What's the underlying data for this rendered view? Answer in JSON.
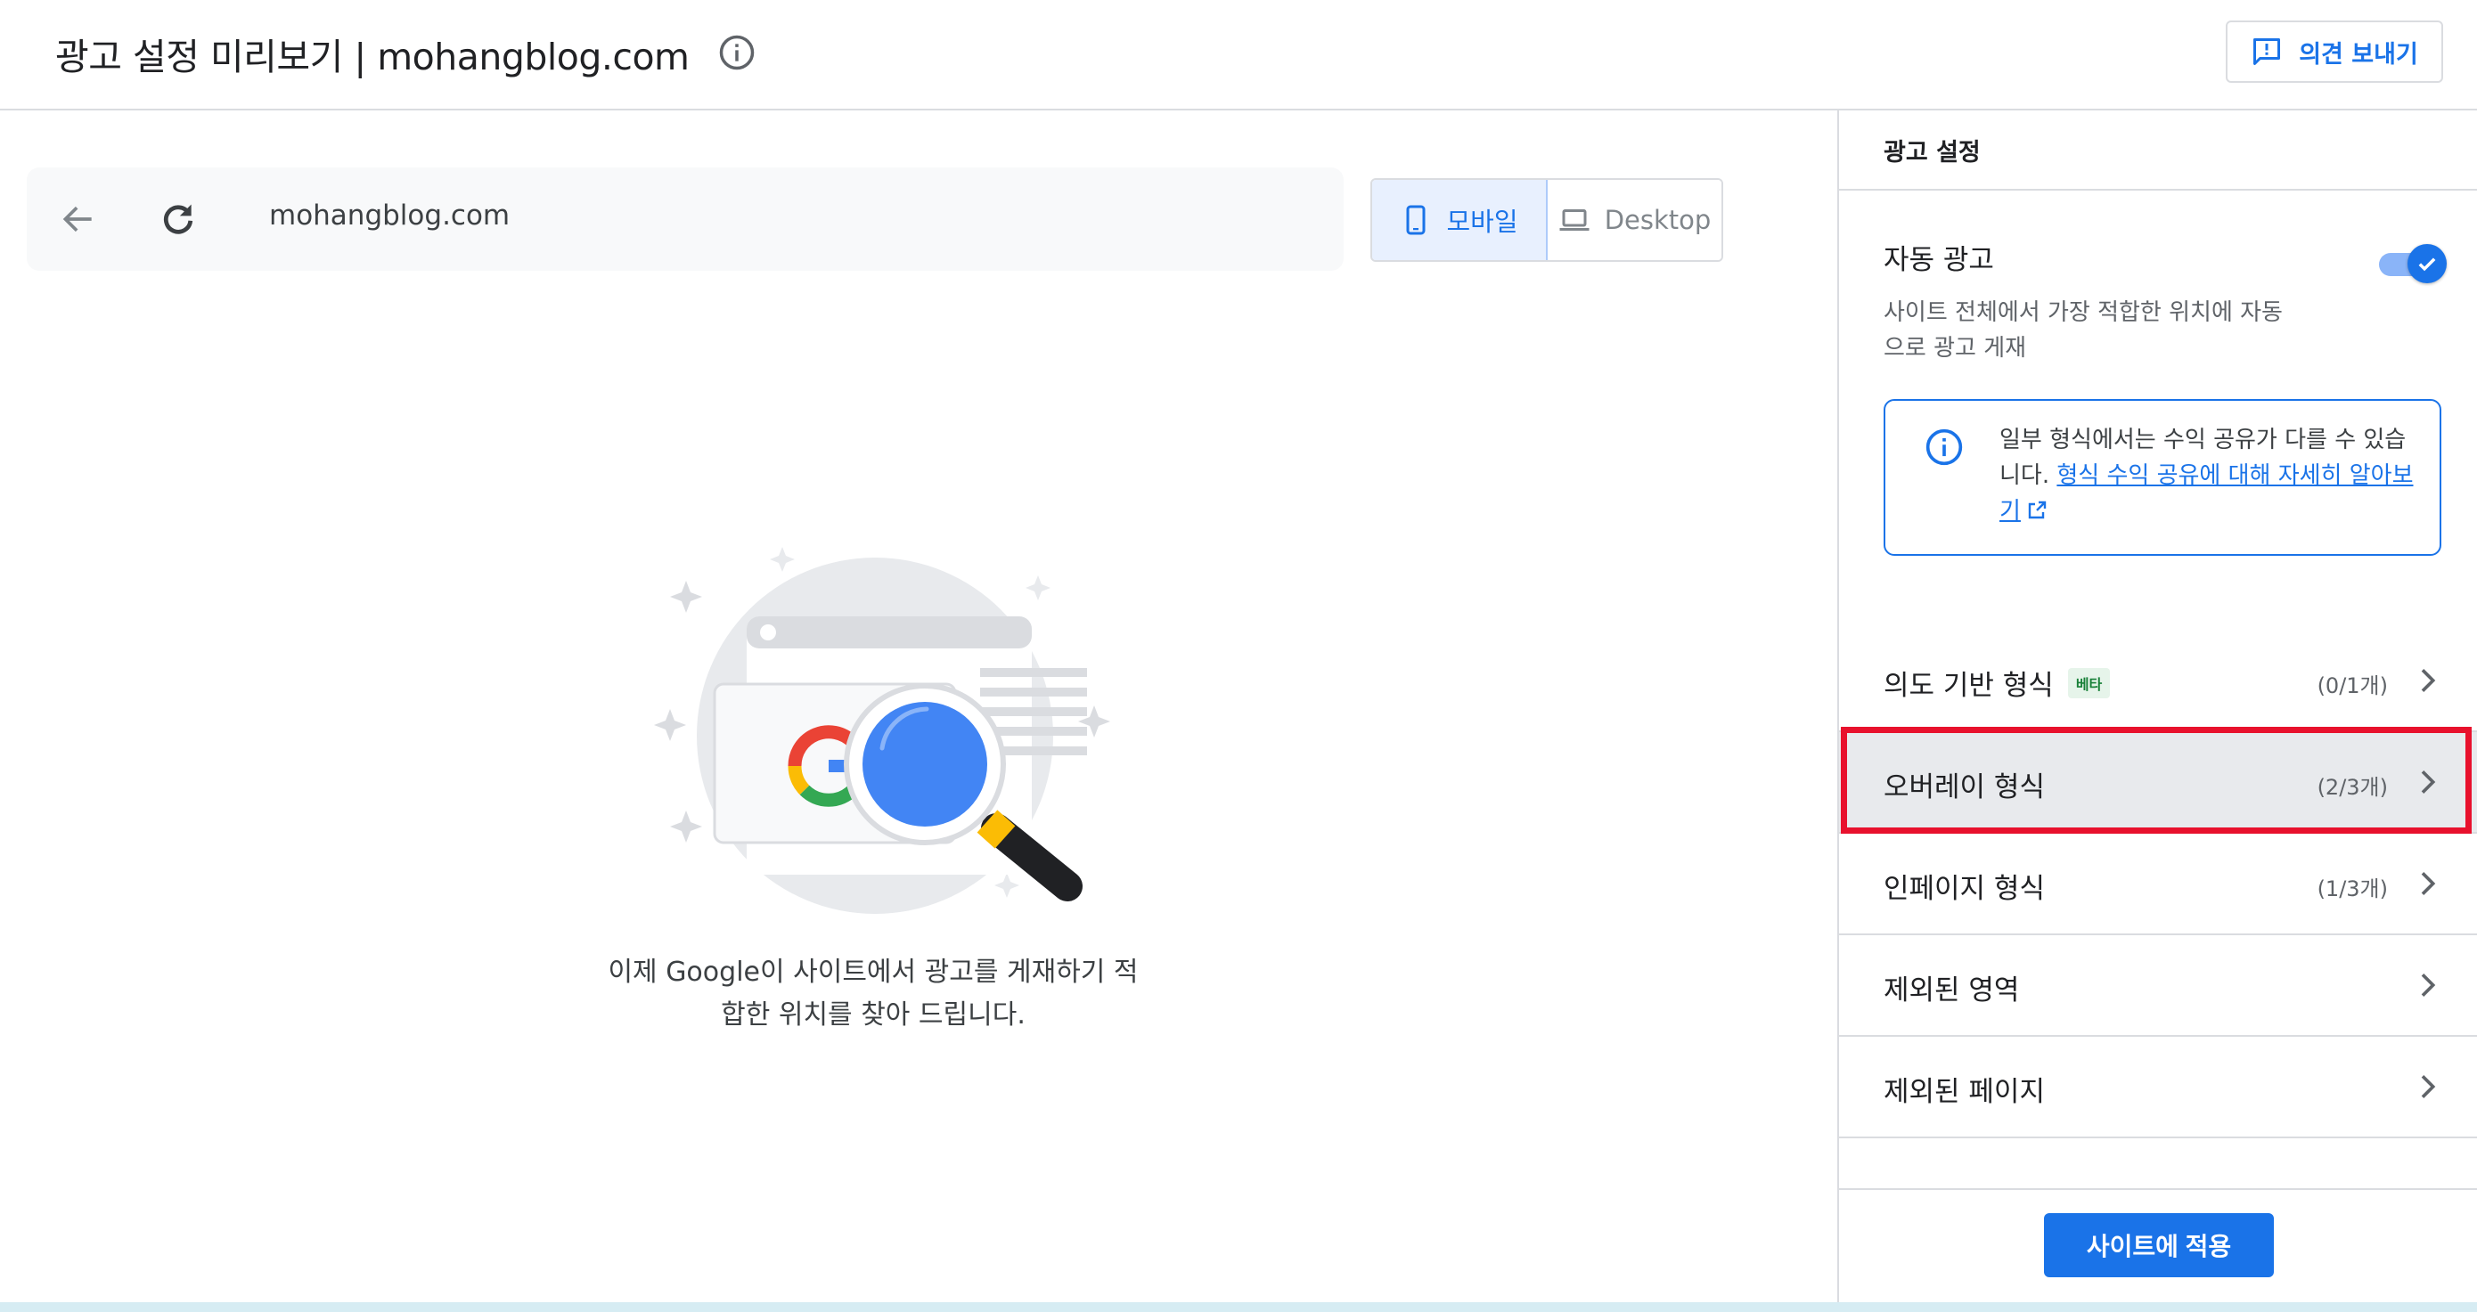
{
  "header": {
    "title": "광고 설정 미리보기 | mohangblog.com",
    "feedback_label": "의견 보내기"
  },
  "preview": {
    "url": "mohangblog.com",
    "device_mobile": "모바일",
    "device_desktop": "Desktop",
    "active_device": "mobile",
    "message_line1": "이제 Google이 사이트에서 광고를 게재하기 적",
    "message_line2": "합한 위치를 찾아 드립니다."
  },
  "panel": {
    "title": "광고 설정",
    "auto_ads": {
      "title": "자동 광고",
      "enabled": true,
      "desc": "사이트 전체에서 가장 적합한 위치에 자동으로 광고 게재"
    },
    "info": {
      "text": "일부 형식에서는 수익 공유가 다를 수 있습니다.",
      "link": "형식 수익 공유에 대해 자세히 알아보기"
    },
    "rows": [
      {
        "label": "의도 기반 형식",
        "badge": "베타",
        "count": "(0/1개)"
      },
      {
        "label": "오버레이 형식",
        "badge": "",
        "count": "(2/3개)"
      },
      {
        "label": "인페이지 형식",
        "badge": "",
        "count": "(1/3개)"
      },
      {
        "label": "제외된 영역",
        "badge": "",
        "count": ""
      },
      {
        "label": "제외된 페이지",
        "badge": "",
        "count": ""
      }
    ],
    "highlighted_row": 1,
    "apply_label": "사이트에 적용"
  },
  "colors": {
    "accent": "#1a73e8",
    "highlight": "#e8112d"
  },
  "icons": [
    "info-icon",
    "feedback-icon",
    "back-arrow-icon",
    "refresh-icon",
    "phone-icon",
    "laptop-icon",
    "check-icon",
    "external-link-icon",
    "chevron-right-icon"
  ]
}
